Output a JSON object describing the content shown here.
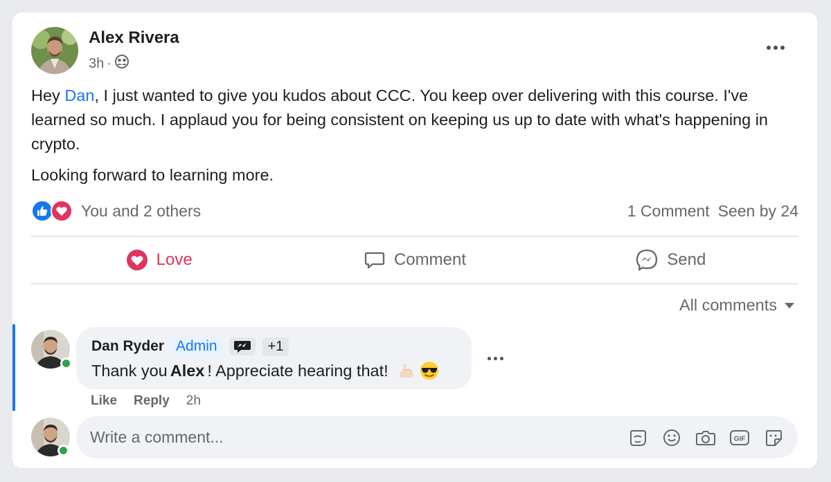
{
  "post": {
    "author": "Alex Rivera",
    "time": "3h",
    "separator": "·",
    "audience_icon": "friends-icon",
    "body": {
      "p1_before": "Hey ",
      "mention": "Dan",
      "p1_after": ", I just wanted to give you kudos about CCC. You keep over delivering with this course. I've learned so much. I applaud you for being consistent on keeping us up to date with what's happening in crypto.",
      "p2": "Looking forward to learning more."
    },
    "reactions": {
      "types": [
        "like",
        "love"
      ],
      "summary": "You and 2 others",
      "comments_count": "1 Comment",
      "seen_by": "Seen by 24"
    },
    "actions": {
      "love": "Love",
      "comment": "Comment",
      "send": "Send"
    }
  },
  "comments": {
    "filter_label": "All comments",
    "items": [
      {
        "author": "Dan Ryder",
        "badge": "Admin",
        "extra_badge": "+1",
        "text_before": "Thank you ",
        "text_bold": "Alex",
        "text_after": "! Appreciate hearing that!",
        "emojis": [
          "flexed-biceps",
          "smiling-face-with-sunglasses"
        ],
        "like_label": "Like",
        "reply_label": "Reply",
        "time": "2h"
      }
    ]
  },
  "composer": {
    "placeholder": "Write a comment...",
    "tools": [
      "avatar-sticker-icon",
      "emoji-icon",
      "camera-icon",
      "gif-icon",
      "sticker-icon"
    ]
  },
  "colors": {
    "accent": "#1877f2",
    "love": "#e0335d",
    "online": "#31a24c"
  }
}
